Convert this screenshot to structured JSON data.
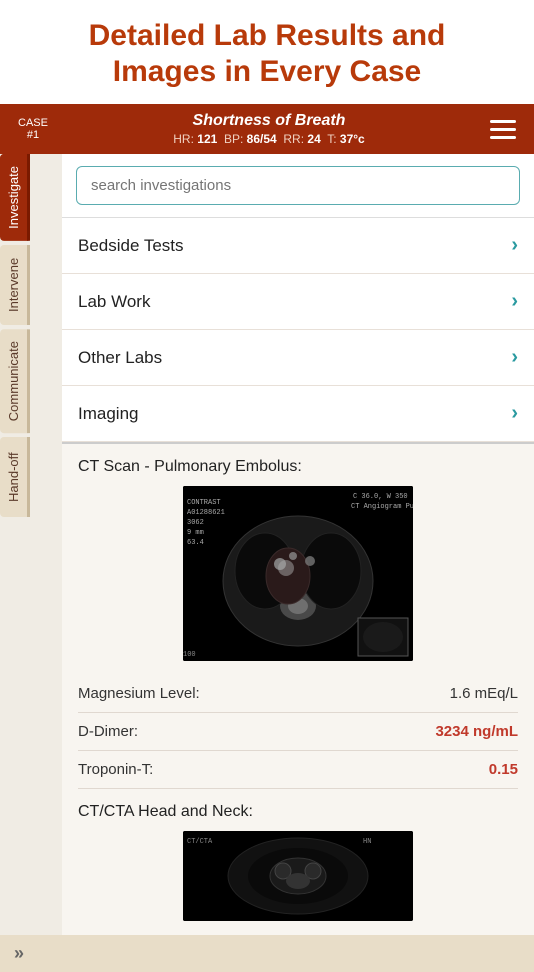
{
  "page": {
    "title_line1": "Detailed Lab Results and",
    "title_line2": "Images in Every Case"
  },
  "case_bar": {
    "case_label": "Case",
    "case_number": "#1",
    "case_name": "Shortness of Breath",
    "vitals": {
      "hr_label": "HR:",
      "hr_value": "121",
      "bp_label": "BP:",
      "bp_value": "86/54",
      "rr_label": "RR:",
      "rr_value": "24",
      "t_label": "T:",
      "t_value": "37°c"
    },
    "menu_icon": "☰"
  },
  "search": {
    "placeholder": "search investigations"
  },
  "sidebar": {
    "tabs": [
      {
        "id": "investigate",
        "label": "Investigate",
        "active": true
      },
      {
        "id": "intervene",
        "label": "Intervene",
        "active": false
      },
      {
        "id": "communicate",
        "label": "Communicate",
        "active": false
      },
      {
        "id": "handoff",
        "label": "Hand-off",
        "active": false
      }
    ]
  },
  "menu": {
    "items": [
      {
        "id": "bedside-tests",
        "label": "Bedside Tests"
      },
      {
        "id": "lab-work",
        "label": "Lab Work"
      },
      {
        "id": "other-labs",
        "label": "Other Labs"
      },
      {
        "id": "imaging",
        "label": "Imaging"
      }
    ]
  },
  "results": {
    "ct_scan_label": "CT Scan - Pulmonary Embolus:",
    "ct_annotation_top": "C  36.0, W  350",
    "ct_annotation_left_lines": [
      "CONTRAST",
      "A01288621",
      "3062",
      "9 mm",
      "63.4"
    ],
    "lab_rows": [
      {
        "label": "Magnesium Level:",
        "value": "1.6 mEq/L",
        "abnormal": false
      },
      {
        "label": "D-Dimer:",
        "value": "3234 ng/mL",
        "abnormal": true
      },
      {
        "label": "Troponin-T:",
        "value": "0.15",
        "abnormal": true
      }
    ],
    "cta_label": "CT/CTA Head and Neck:"
  },
  "bottom": {
    "arrows": "»"
  }
}
